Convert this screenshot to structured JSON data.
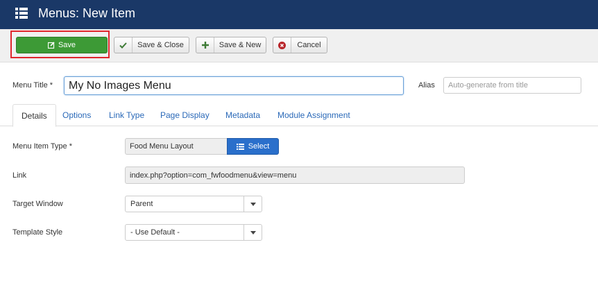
{
  "header": {
    "title": "Menus: New Item",
    "icon": "list-icon"
  },
  "toolbar": {
    "save": "Save",
    "save_close": "Save & Close",
    "save_new": "Save & New",
    "cancel": "Cancel"
  },
  "form": {
    "menu_title_label": "Menu Title *",
    "menu_title_value": "My No Images Menu",
    "alias_label": "Alias",
    "alias_placeholder": "Auto-generate from title"
  },
  "tabs": [
    "Details",
    "Options",
    "Link Type",
    "Page Display",
    "Metadata",
    "Module Assignment"
  ],
  "details": {
    "menu_item_type_label": "Menu Item Type *",
    "menu_item_type_value": "Food Menu Layout",
    "select_label": "Select",
    "link_label": "Link",
    "link_value": "index.php?option=com_fwfoodmenu&view=menu",
    "target_window_label": "Target Window",
    "target_window_value": "Parent",
    "template_style_label": "Template Style",
    "template_style_value": "- Use Default -"
  },
  "colors": {
    "header": "#1a3867",
    "save": "#3d9a36",
    "select": "#2a6fcb",
    "highlight": "#e0262d"
  }
}
